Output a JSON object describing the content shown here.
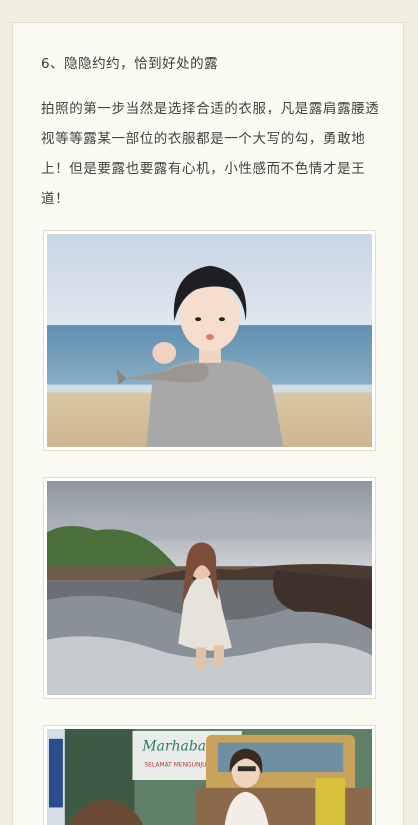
{
  "article": {
    "heading": "6、隐隐约约，恰到好处的露",
    "paragraph": "拍照的第一步当然是选择合适的衣服，凡是露肩露腰透视等等露某一部位的衣服都是一个大写的勾，勇敢地上！但是要露也要露有心机，小性感而不色情才是王道！"
  },
  "photos": [
    {
      "name": "photo-beach-girl-fish",
      "sign_text": ""
    },
    {
      "name": "photo-rocky-shore-girl",
      "sign_text": ""
    },
    {
      "name": "photo-street-cart-sign",
      "sign_text": "Marhaban",
      "sign_subtext": "SELAMAT MENGUNJUNGI"
    }
  ],
  "colors": {
    "page_bg": "#f2efe2",
    "card_bg": "#fbfaf3",
    "text": "#44423c"
  }
}
